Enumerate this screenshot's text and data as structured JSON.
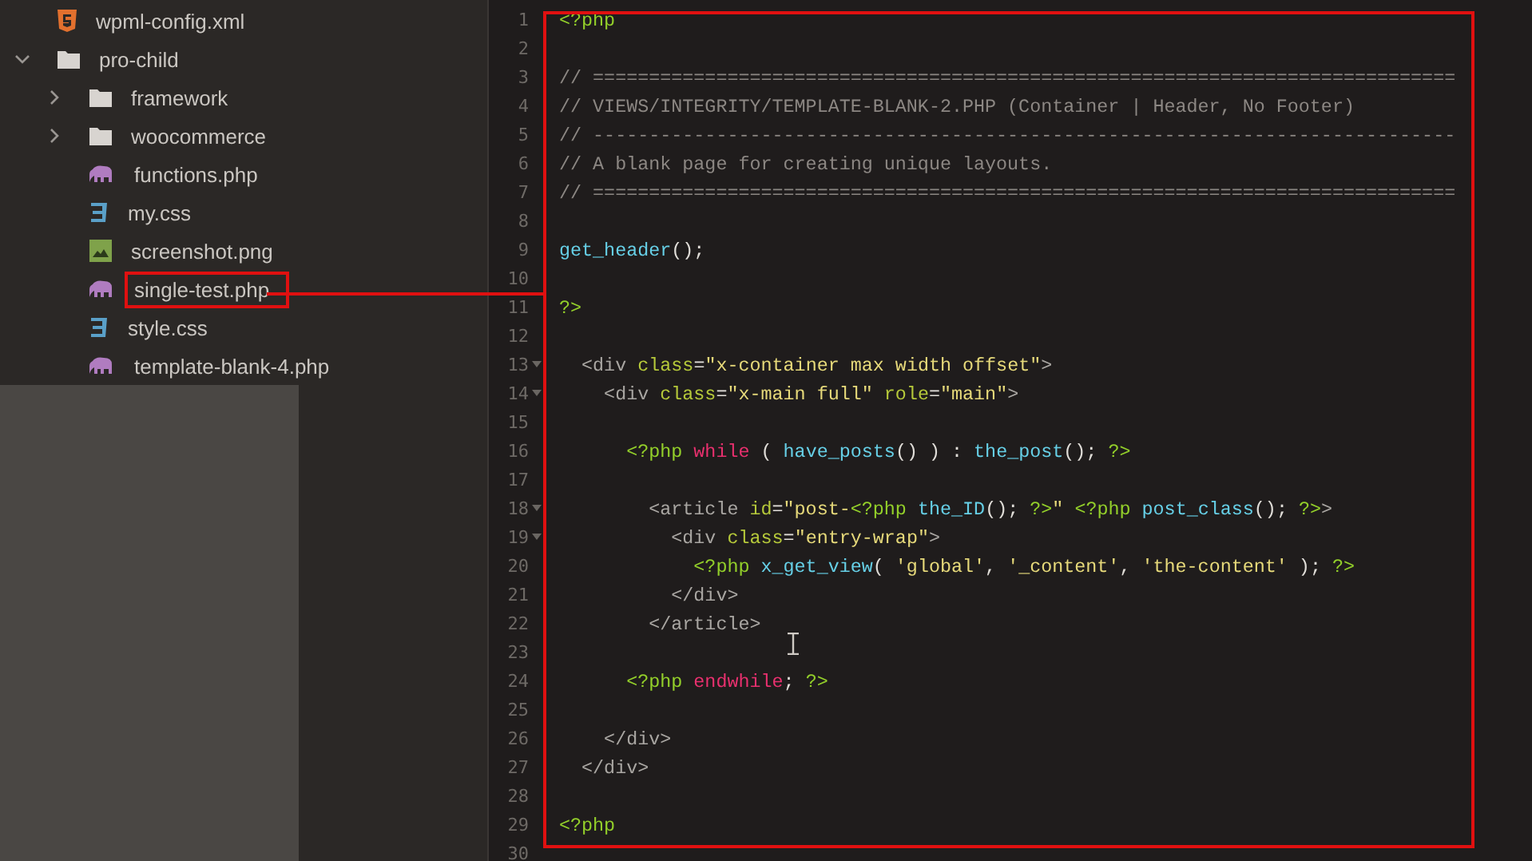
{
  "sidebar": {
    "tree": [
      {
        "label": "wpml-config.xml",
        "kind": "html",
        "annotated": false
      },
      {
        "label": "pro-child",
        "kind": "folder",
        "expanded": true,
        "annotated": false,
        "children": [
          {
            "label": "framework",
            "kind": "folder",
            "expanded": false,
            "annotated": false
          },
          {
            "label": "woocommerce",
            "kind": "folder",
            "expanded": false,
            "annotated": false
          },
          {
            "label": "functions.php",
            "kind": "php",
            "annotated": false
          },
          {
            "label": "my.css",
            "kind": "css",
            "annotated": false
          },
          {
            "label": "screenshot.png",
            "kind": "image",
            "annotated": false
          },
          {
            "label": "single-test.php",
            "kind": "php",
            "annotated": true
          },
          {
            "label": "style.css",
            "kind": "css",
            "annotated": false
          },
          {
            "label": "template-blank-4.php",
            "kind": "php",
            "annotated": false
          }
        ]
      }
    ]
  },
  "editor": {
    "lines": [
      {
        "num": "1",
        "foldable": false,
        "tokens": [
          {
            "kind": "php",
            "t": "<?php"
          }
        ]
      },
      {
        "num": "2",
        "foldable": false
      },
      {
        "num": "3",
        "foldable": false,
        "tokens": [
          {
            "kind": "comment",
            "t": "// ============================================================================="
          }
        ]
      },
      {
        "num": "4",
        "foldable": false,
        "tokens": [
          {
            "kind": "comment",
            "t": "// VIEWS/INTEGRITY/TEMPLATE-BLANK-2.PHP (Container | Header, No Footer)"
          }
        ]
      },
      {
        "num": "5",
        "foldable": false,
        "tokens": [
          {
            "kind": "comment",
            "t": "// -----------------------------------------------------------------------------"
          }
        ]
      },
      {
        "num": "6",
        "foldable": false,
        "tokens": [
          {
            "kind": "comment",
            "t": "// A blank page for creating unique layouts."
          }
        ]
      },
      {
        "num": "7",
        "foldable": false,
        "tokens": [
          {
            "kind": "comment",
            "t": "// ============================================================================="
          }
        ]
      },
      {
        "num": "8",
        "foldable": false
      },
      {
        "num": "9",
        "foldable": false,
        "tokens": [
          {
            "kind": "fn",
            "t": "get_header"
          },
          {
            "kind": "plain",
            "t": "();"
          }
        ]
      },
      {
        "num": "10",
        "foldable": false
      },
      {
        "num": "11",
        "foldable": false,
        "tokens": [
          {
            "kind": "php",
            "t": "?>"
          }
        ]
      },
      {
        "num": "12",
        "foldable": false
      },
      {
        "num": "13",
        "foldable": true,
        "tokens": [
          {
            "kind": "tag",
            "t": "  <div "
          },
          {
            "kind": "attr",
            "t": "class"
          },
          {
            "kind": "plain",
            "t": "="
          },
          {
            "kind": "str",
            "t": "\"x-container max width offset\""
          },
          {
            "kind": "tag",
            "t": ">"
          }
        ]
      },
      {
        "num": "14",
        "foldable": true,
        "tokens": [
          {
            "kind": "tag",
            "t": "    <div "
          },
          {
            "kind": "attr",
            "t": "class"
          },
          {
            "kind": "plain",
            "t": "="
          },
          {
            "kind": "str",
            "t": "\"x-main full\" "
          },
          {
            "kind": "attr",
            "t": "role"
          },
          {
            "kind": "plain",
            "t": "="
          },
          {
            "kind": "str",
            "t": "\"main\""
          },
          {
            "kind": "tag",
            "t": ">"
          }
        ]
      },
      {
        "num": "15",
        "foldable": false
      },
      {
        "num": "16",
        "foldable": false,
        "tokens": [
          {
            "kind": "php",
            "t": "      <?php "
          },
          {
            "kind": "kw",
            "t": "while"
          },
          {
            "kind": "plain",
            "t": " ( "
          },
          {
            "kind": "fn",
            "t": "have_posts"
          },
          {
            "kind": "plain",
            "t": "() ) : "
          },
          {
            "kind": "fn",
            "t": "the_post"
          },
          {
            "kind": "plain",
            "t": "(); "
          },
          {
            "kind": "php",
            "t": "?>"
          }
        ]
      },
      {
        "num": "17",
        "foldable": false
      },
      {
        "num": "18",
        "foldable": true,
        "tokens": [
          {
            "kind": "tag",
            "t": "        <article "
          },
          {
            "kind": "attr",
            "t": "id"
          },
          {
            "kind": "plain",
            "t": "="
          },
          {
            "kind": "str",
            "t": "\"post-"
          },
          {
            "kind": "php",
            "t": "<?php "
          },
          {
            "kind": "fn",
            "t": "the_ID"
          },
          {
            "kind": "plain",
            "t": "(); "
          },
          {
            "kind": "php",
            "t": "?>"
          },
          {
            "kind": "str",
            "t": "\" "
          },
          {
            "kind": "php",
            "t": "<?php "
          },
          {
            "kind": "fn",
            "t": "post_class"
          },
          {
            "kind": "plain",
            "t": "(); "
          },
          {
            "kind": "php",
            "t": "?>"
          },
          {
            "kind": "tag",
            "t": ">"
          }
        ]
      },
      {
        "num": "19",
        "foldable": true,
        "tokens": [
          {
            "kind": "tag",
            "t": "          <div "
          },
          {
            "kind": "attr",
            "t": "class"
          },
          {
            "kind": "plain",
            "t": "="
          },
          {
            "kind": "str",
            "t": "\"entry-wrap\""
          },
          {
            "kind": "tag",
            "t": ">"
          }
        ]
      },
      {
        "num": "20",
        "foldable": false,
        "tokens": [
          {
            "kind": "php",
            "t": "            <?php "
          },
          {
            "kind": "fn",
            "t": "x_get_view"
          },
          {
            "kind": "plain",
            "t": "( "
          },
          {
            "kind": "str",
            "t": "'global'"
          },
          {
            "kind": "plain",
            "t": ", "
          },
          {
            "kind": "str",
            "t": "'_content'"
          },
          {
            "kind": "plain",
            "t": ", "
          },
          {
            "kind": "str",
            "t": "'the-content'"
          },
          {
            "kind": "plain",
            "t": " ); "
          },
          {
            "kind": "php",
            "t": "?>"
          }
        ]
      },
      {
        "num": "21",
        "foldable": false,
        "tokens": [
          {
            "kind": "tag",
            "t": "          </div>"
          }
        ]
      },
      {
        "num": "22",
        "foldable": false,
        "tokens": [
          {
            "kind": "tag",
            "t": "        </article>"
          }
        ]
      },
      {
        "num": "23",
        "foldable": false
      },
      {
        "num": "24",
        "foldable": false,
        "tokens": [
          {
            "kind": "php",
            "t": "      <?php "
          },
          {
            "kind": "kw",
            "t": "endwhile"
          },
          {
            "kind": "plain",
            "t": "; "
          },
          {
            "kind": "php",
            "t": "?>"
          }
        ]
      },
      {
        "num": "25",
        "foldable": false
      },
      {
        "num": "26",
        "foldable": false,
        "tokens": [
          {
            "kind": "tag",
            "t": "    </div>"
          }
        ]
      },
      {
        "num": "27",
        "foldable": false,
        "tokens": [
          {
            "kind": "tag",
            "t": "  </div>"
          }
        ]
      },
      {
        "num": "28",
        "foldable": false
      },
      {
        "num": "29",
        "foldable": false,
        "tokens": [
          {
            "kind": "php",
            "t": "<?php"
          }
        ]
      },
      {
        "num": "30",
        "foldable": false
      }
    ]
  }
}
